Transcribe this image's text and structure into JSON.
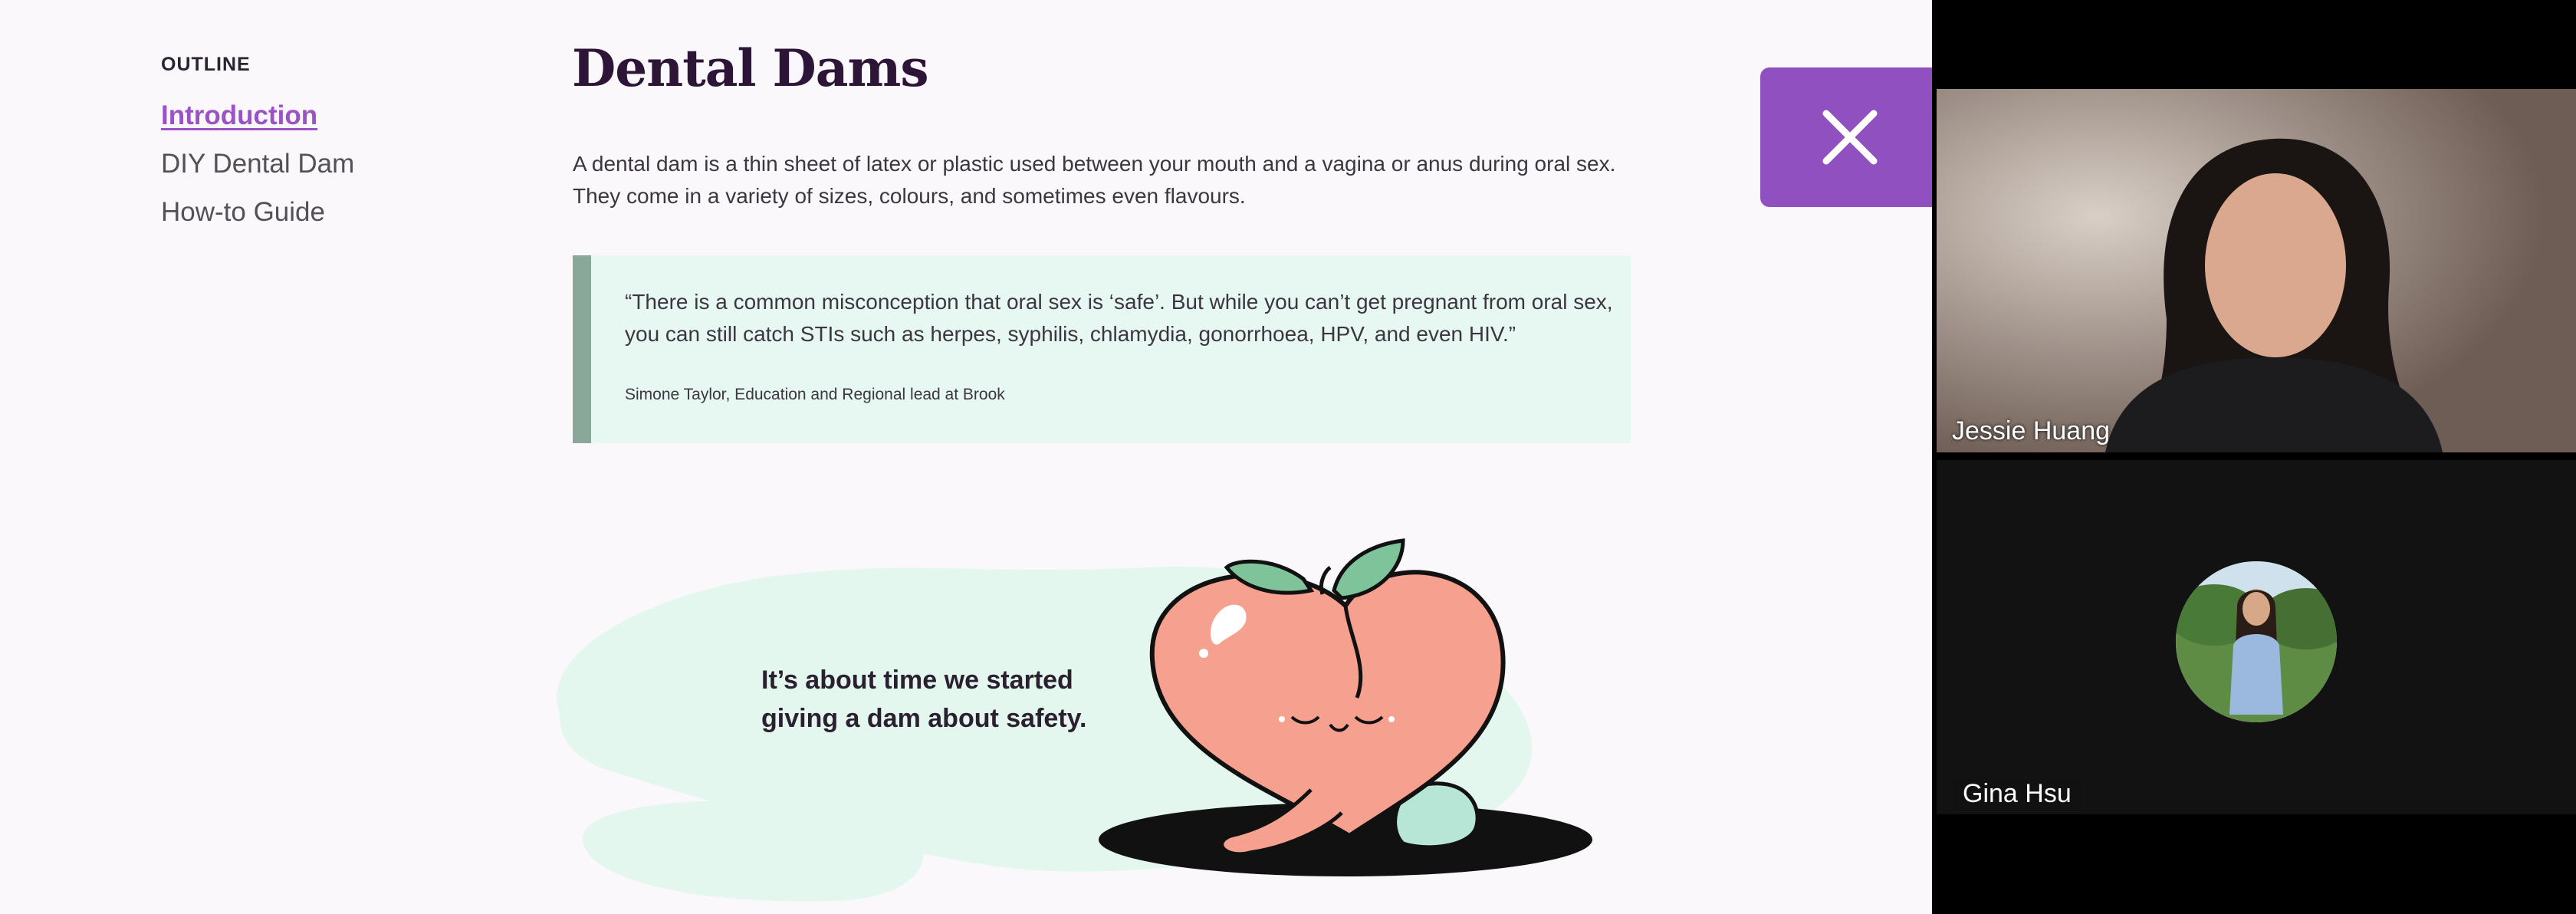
{
  "outline": {
    "heading": "OUTLINE",
    "items": [
      {
        "label": "Introduction",
        "active": true
      },
      {
        "label": "DIY Dental Dam",
        "active": false
      },
      {
        "label": "How-to Guide",
        "active": false
      }
    ]
  },
  "article": {
    "title": "Dental Dams",
    "intro": "A dental dam is a thin sheet of latex or plastic used between your mouth and a vagina or anus during oral sex. They come in a variety of sizes, colours, and sometimes even flavours.",
    "quote": {
      "text": "“There is a common misconception that oral sex is ‘safe’. But while you can’t get pregnant from oral sex, you can still catch STIs such as herpes, syphilis, chlamydia, gonorrhoea, HPV, and even HIV.”",
      "citation": "Simone Taylor, Education and Regional lead at Brook"
    },
    "tagline_line1": "It’s about time we started",
    "tagline_line2": "giving a dam about safety."
  },
  "close_button": {
    "icon": "close-icon"
  },
  "video_call": {
    "participants": [
      {
        "name": "Jessie Huang"
      },
      {
        "name": "Gina Hsu"
      }
    ]
  },
  "colors": {
    "accent": "#9050bf",
    "link_active": "#9a52c5",
    "quote_bg": "#e6f8f1",
    "quote_bar": "#8aa89a",
    "peach": "#f6a08f",
    "mint": "#e4f7ef"
  }
}
